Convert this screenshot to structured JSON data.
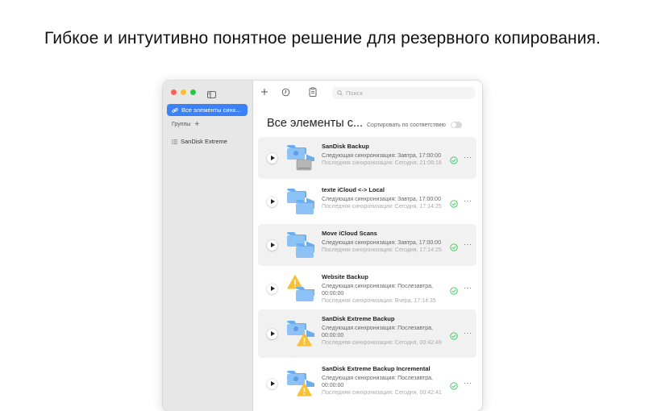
{
  "headline": "Гибкое и интуитивно понятное решение для резервного копирования.",
  "colors": {
    "accent": "#3b82f6",
    "folder": "#6aaef0",
    "warning": "#f7c137",
    "success": "#34c759"
  },
  "sidebar": {
    "selected_item": "Все элементы синх...",
    "groups_label": "Группы",
    "group_items": [
      {
        "label": "SanDisk Extreme"
      }
    ]
  },
  "toolbar": {
    "add_icon": "plus-icon",
    "history_icon": "clock-icon",
    "clipboard_icon": "clipboard-icon",
    "search_placeholder": "Поиск"
  },
  "main": {
    "title": "Все элементы с...",
    "sort_label": "Сортировать по соответствию",
    "sort_enabled": false
  },
  "items": [
    {
      "name": "SanDisk Backup",
      "next": "Следующая синхронизация: Завтра, 17:00:00",
      "last": "Последняя синхронизация: Сегодня, 21:08:18",
      "icon": "folder-to-drive",
      "status": "success"
    },
    {
      "name": "texte iCloud <-> Local",
      "next": "Следующая синхронизация: Завтра, 17:00:00",
      "last": "Последняя синхронизация: Сегодня, 17:14:25",
      "icon": "folder-to-folder",
      "status": "success"
    },
    {
      "name": "Move iCloud Scans",
      "next": "Следующая синхронизация: Завтра, 17:00:00",
      "last": "Последняя синхронизация: Сегодня, 17:14:25",
      "icon": "folder-to-folder",
      "status": "success"
    },
    {
      "name": "Website Backup",
      "next": "Следующая синхронизация: Послезавтра, 00:00:00",
      "last": "Последняя синхронизация: Вчера, 17:14:35",
      "icon": "warning-to-folder",
      "status": "success"
    },
    {
      "name": "SanDisk Extreme Backup",
      "next": "Следующая синхронизация: Послезавтра, 00:00:00",
      "last": "Последняя синхронизация: Сегодня, 00:42:49",
      "icon": "folder-to-warning",
      "status": "success"
    },
    {
      "name": "SanDisk Extreme Backup Incremental",
      "next": "Следующая синхронизация: Послезавтра, 00:00:00",
      "last": "Последняя синхронизация: Сегодня, 00:42:41",
      "icon": "folder-to-warning",
      "status": "success"
    }
  ]
}
